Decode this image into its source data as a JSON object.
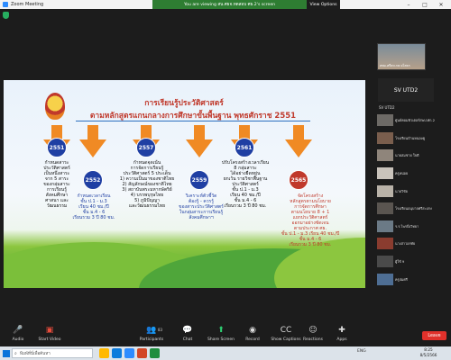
{
  "window": {
    "title": "Zoom Meeting",
    "viewing_banner": "You are viewing สน.ศธจ.ทดสอบ ศธ.2's screen",
    "view_options": "View Options"
  },
  "slide": {
    "title": "การเรียนรู้ประวัติศาสตร์",
    "subtitle": "ตามหลักสูตรแกนกลางการศึกษาขั้นพื้นฐาน พุทธศักราช 2551",
    "timeline": [
      {
        "year": "2551",
        "text": "กำหนดสาระ\nประวัติศาสตร์\nเป็นหนึ่งสาระ\nจาก 5 สาระ\nของกลุ่มสาระ\nการเรียนรู้\nสังคมศึกษา\nศาสนา และ\nวัฒนธรรม",
        "color": "black"
      },
      {
        "year": "2552",
        "text": "กำหนดเวลาเรียน\nชั้น ป.1 - ม.3\nเรียน 40 ชม./ปี\nชั้น ม.4 - 6\nเรียนรวม 3 ปี 80 ชม.",
        "color": "blue"
      },
      {
        "year": "2557",
        "text": "กำหนดจุดเน้น\nการจัดการเรียนรู้\nประวัติศาสตร์ 5 ประเด็น\n1) ความเป็นมาของชาติไทย\n2) สัญลักษณ์ของชาติไทย\n3) สถาบันพระมหากษัตริย์\n4) บรรพบุรุษไทย\n5) ภูมิปัญญา\nและวัฒนธรรมไทย",
        "color": "black"
      },
      {
        "year": "2559",
        "text": "วิเคราะห์ตัวชี้วัด\nต้องรู้ - ควรรู้\nของสาระประวัติศาสตร์\nในกลุ่มสาระการเรียนรู้\nสังคมศึกษาฯ",
        "color": "blue"
      },
      {
        "year": "2561",
        "text": "ปรับโครงสร้างเวลาเรียน\n8 กลุ่มสาระ\nได้อย่างยืดหยุ่น\nยกเว้น รายวิชาพื้นฐาน\nประวัติศาสตร์\nชั้น ป.1 - ม.3\nเรียน 40 ชม./ปี\nชั้น ม.4 - 6\nเรียนรวม 3 ปี 80 ชม.",
        "color": "black"
      },
      {
        "year": "2565",
        "text": "จัดโครงสร้าง\nหลักสูตรตามนโยบาย\nการจัดการศึกษา\nตามนโยบาย 8 + 1\nแยกประวัติศาสตร์\nออกมาอย่างชัดเจน\nตามประกาศ ศธ.\nชั้น ป.1 - ม.3 เรียน 40 ชม./ปี\nชั้น ม.4 - 6\nเรียนรวม 3 ปี 80 ชม.",
        "color": "red"
      }
    ]
  },
  "participants_panel": {
    "top_tile_label": "สพม.ศรีสะเกษ ยโสธร",
    "speaker_name": "SV UTD2",
    "speaker_label": "SV UTD2",
    "participants": [
      {
        "name": "ศูนย์คอมพิวเตอร์สพป.ศก.2"
      },
      {
        "name": "โรงเรียนบ้านหนองคู"
      },
      {
        "name": "นายสมชาย ใจดี"
      },
      {
        "name": "ครูหน่อย"
      },
      {
        "name": "นายวิชัย"
      },
      {
        "name": "โรงเรียนอนุบาลศรีสะเกษ"
      },
      {
        "name": "ร.ร.ไพรบึงวิทยา"
      },
      {
        "name": "นางสาวอรทัย"
      },
      {
        "name": "ผู้ใช้ 9"
      },
      {
        "name": "ครูสมศรี"
      }
    ]
  },
  "toolbar": {
    "audio": "Audio",
    "start_video": "Start Video",
    "participants": "Participants",
    "participants_count": "83",
    "chat": "Chat",
    "share_screen": "Share Screen",
    "record": "Record",
    "show_captions": "Show Captions",
    "reactions": "Reactions",
    "apps": "Apps",
    "leave": "Leave"
  },
  "taskbar": {
    "search_placeholder": "พิมพ์ที่นี่เพื่อค้นหา",
    "language": "ENG",
    "time": "8:25",
    "date": "8/5/2566"
  }
}
